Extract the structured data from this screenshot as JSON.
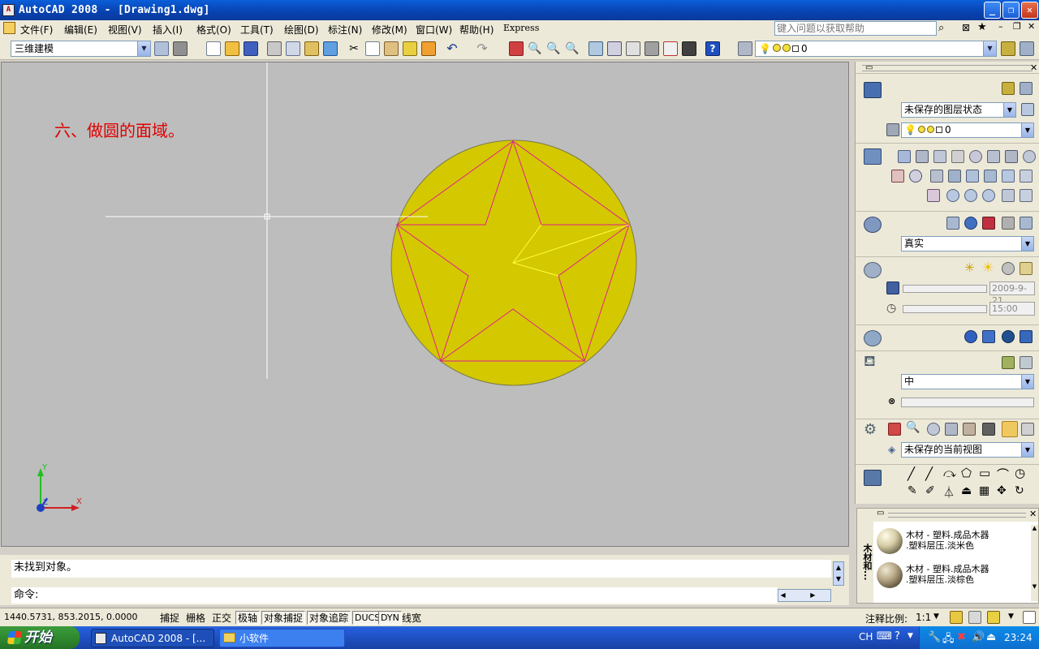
{
  "window": {
    "title": "AutoCAD 2008 - [Drawing1.dwg]"
  },
  "menu": {
    "items": [
      "文件(F)",
      "编辑(E)",
      "视图(V)",
      "插入(I)",
      "格式(O)",
      "工具(T)",
      "绘图(D)",
      "标注(N)",
      "修改(M)",
      "窗口(W)",
      "帮助(H)",
      "Express"
    ],
    "ask_placeholder": "键入问题以获取帮助"
  },
  "toolbar": {
    "workspace": "三维建模",
    "layer_value": "0"
  },
  "canvas": {
    "annotation": "六、做圆的面域。",
    "colors": {
      "background": "#bdbdbd",
      "region_fill": "#d4c800",
      "star_lines": "#e0208c",
      "highlight_lines": "#ffff40",
      "annotation": "#e00000"
    },
    "ucs": {
      "x_label": "X",
      "y_label": "Y",
      "z_label": "Z"
    }
  },
  "command": {
    "history": "未找到对象。",
    "prompt": "命令:"
  },
  "status": {
    "coords": "1440.5731, 853.2015, 0.0000",
    "toggles": [
      {
        "label": "捕捉",
        "on": false
      },
      {
        "label": "栅格",
        "on": false
      },
      {
        "label": "正交",
        "on": false
      },
      {
        "label": "极轴",
        "on": true
      },
      {
        "label": "对象捕捉",
        "on": true
      },
      {
        "label": "对象追踪",
        "on": true
      },
      {
        "label": "DUCS",
        "on": true
      },
      {
        "label": "DYN",
        "on": true
      },
      {
        "label": "线宽",
        "on": false
      }
    ],
    "scale_label": "注释比例:",
    "scale_value": "1:1"
  },
  "palette": {
    "layer_state": "未保存的图层状态",
    "layer": "0",
    "visual_style": "真实",
    "date": "2009-9-21",
    "time": "15:00",
    "material_mode": "中",
    "view": "未保存的当前视图"
  },
  "materials": {
    "title": "木材和...",
    "items": [
      {
        "line1": "木材 - 塑料.成品木器",
        "line2": ".塑料层压.淡米色"
      },
      {
        "line1": "木材 - 塑料.成品木器",
        "line2": ".塑料层压.淡棕色"
      }
    ]
  },
  "taskbar": {
    "start": "开始",
    "tasks": [
      "AutoCAD 2008 - [...",
      "小软件"
    ],
    "lang": "CH",
    "clock": "23:24"
  }
}
